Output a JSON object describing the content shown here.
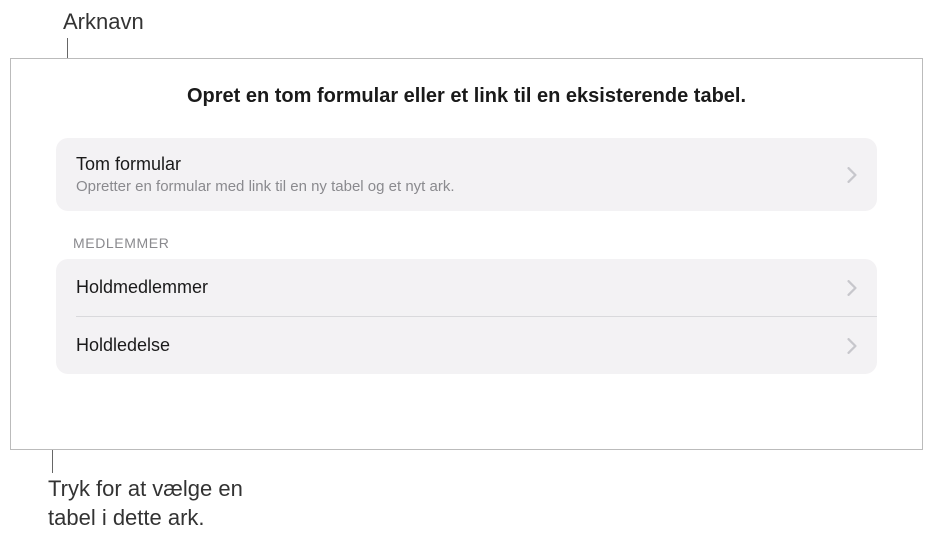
{
  "callouts": {
    "top": "Arknavn",
    "bottom_line1": "Tryk for at vælge en",
    "bottom_line2": "tabel i dette ark."
  },
  "panel": {
    "title": "Opret en tom formular eller et link til en eksisterende tabel.",
    "primary_option": {
      "title": "Tom formular",
      "subtitle": "Opretter en formular med link til en ny tabel og et nyt ark."
    },
    "section_header": "MEDLEMMER",
    "tables": [
      {
        "label": "Holdmedlemmer"
      },
      {
        "label": "Holdledelse"
      }
    ]
  }
}
